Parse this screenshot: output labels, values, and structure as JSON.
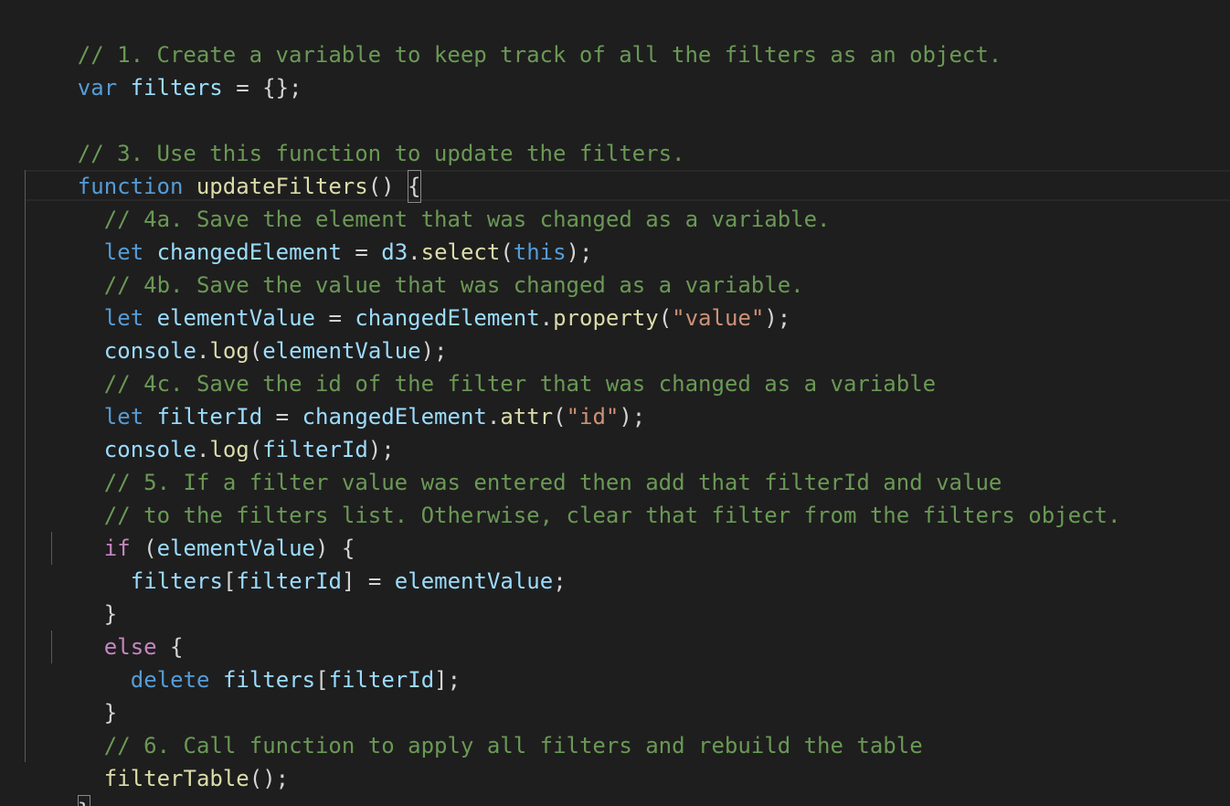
{
  "code": {
    "l1": {
      "comment": "// 1. Create a variable to keep track of all the filters as an object."
    },
    "l2": {
      "kw": "var",
      "name": "filters",
      "rest": " = {};"
    },
    "l4": {
      "comment": "// 3. Use this function to update the filters."
    },
    "l5": {
      "kw": "function",
      "name": "updateFilters",
      "paren": "() ",
      "brace": "{"
    },
    "l6": {
      "comment": "// 4a. Save the element that was changed as a variable."
    },
    "l7": {
      "kw": "let",
      "name": "changedElement",
      "eq": " = ",
      "obj": "d3",
      "dot": ".",
      "method": "select",
      "open": "(",
      "arg": "this",
      "close": ");"
    },
    "l8": {
      "comment": "// 4b. Save the value that was changed as a variable."
    },
    "l9": {
      "kw": "let",
      "name": "elementValue",
      "eq": " = ",
      "obj": "changedElement",
      "dot": ".",
      "method": "property",
      "open": "(",
      "arg": "\"value\"",
      "close": ");"
    },
    "l10": {
      "obj": "console",
      "dot": ".",
      "method": "log",
      "open": "(",
      "arg": "elementValue",
      "close": ");"
    },
    "l11": {
      "comment": "// 4c. Save the id of the filter that was changed as a variable"
    },
    "l12": {
      "kw": "let",
      "name": "filterId",
      "eq": " = ",
      "obj": "changedElement",
      "dot": ".",
      "method": "attr",
      "open": "(",
      "arg": "\"id\"",
      "close": ");"
    },
    "l13": {
      "obj": "console",
      "dot": ".",
      "method": "log",
      "open": "(",
      "arg": "filterId",
      "close": ");"
    },
    "l14": {
      "comment": "// 5. If a filter value was entered then add that filterId and value"
    },
    "l15": {
      "comment": "// to the filters list. Otherwise, clear that filter from the filters object."
    },
    "l16": {
      "kw": "if",
      "open": " (",
      "arg": "elementValue",
      "close": ") {"
    },
    "l17": {
      "obj": "filters",
      "open": "[",
      "arg": "filterId",
      "mid": "] = ",
      "val": "elementValue",
      "close": ";"
    },
    "l18": {
      "brace": "}"
    },
    "l19": {
      "kw": "else",
      "rest": " {"
    },
    "l20": {
      "kw": "delete",
      "obj": "filters",
      "open": "[",
      "arg": "filterId",
      "close": "];"
    },
    "l21": {
      "brace": "}"
    },
    "l22": {
      "comment": "// 6. Call function to apply all filters and rebuild the table"
    },
    "l23": {
      "method": "filterTable",
      "close": "();"
    },
    "l24": {
      "brace": "}"
    }
  }
}
